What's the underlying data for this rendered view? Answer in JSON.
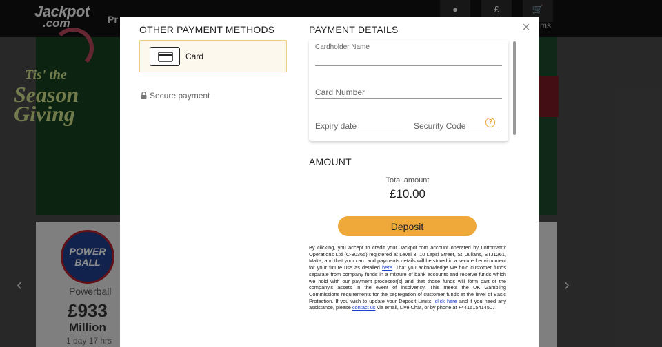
{
  "background": {
    "logo": {
      "line1": "Jackpot",
      "line2": ".com"
    },
    "nav_peek": "Pr",
    "nav_peek_right": "ms",
    "top_icons": [
      {
        "name": "user-icon",
        "glyph": "●"
      },
      {
        "name": "pound-icon",
        "glyph": "£"
      },
      {
        "name": "cart-icon",
        "glyph": "🛒"
      }
    ],
    "hero": {
      "line1": "Tis' the",
      "line2": "Season",
      "line3": "Giving"
    },
    "lottery": {
      "badge_line1": "POWER",
      "badge_line2": "BALL",
      "name": "Powerball",
      "amount": "£933",
      "unit": "Million",
      "time_left": "1 day 17 hrs"
    },
    "arrows": {
      "left": "‹",
      "right": "›"
    }
  },
  "modal": {
    "close_glyph": "×",
    "other_methods": {
      "title": "OTHER PAYMENT METHODS",
      "card_label": "Card",
      "secure_text": "Secure payment"
    },
    "payment_details": {
      "title": "PAYMENT DETAILS",
      "cardholder_label": "Cardholder Name",
      "card_number_placeholder": "Card Number",
      "expiry_placeholder": "Expiry date",
      "security_code_placeholder": "Security Code",
      "help_glyph": "?"
    },
    "amount": {
      "title": "AMOUNT",
      "total_label": "Total amount",
      "total_value": "£10.00"
    },
    "deposit_label": "Deposit",
    "legal": {
      "p1": "By clicking, you accept to credit your Jackpot.com account operated by Lottomatrix Operations Ltd (C-80365) registered at Level 3, 10 Lapsi Street, St. Julians, STJ1261, Malta, and that your card and payments details will be stored in a secured environment for your future use as detailed ",
      "link1": "here",
      "p2": ". That you acknowledge we hold customer funds separate from company funds in a mixture of bank accounts and reserve funds which we hold with our payment processor[s] and that those funds will form part of the company's assets in the event of insolvency. This meets the UK Gambling Commissions requirements for the segregation of customer funds at the level of Basic Protection. If you wish to update your Deposit Limits, ",
      "link2": "click here",
      "p3": " and if you need any assistance, please ",
      "link3": "contact us",
      "p4": " via email, Live Chat, or by phone at +441515414507."
    }
  },
  "colors": {
    "accent": "#efa93a",
    "selected_bg": "#fdf8ed",
    "selected_border": "#f0cf86",
    "link": "#1a3fd1"
  }
}
